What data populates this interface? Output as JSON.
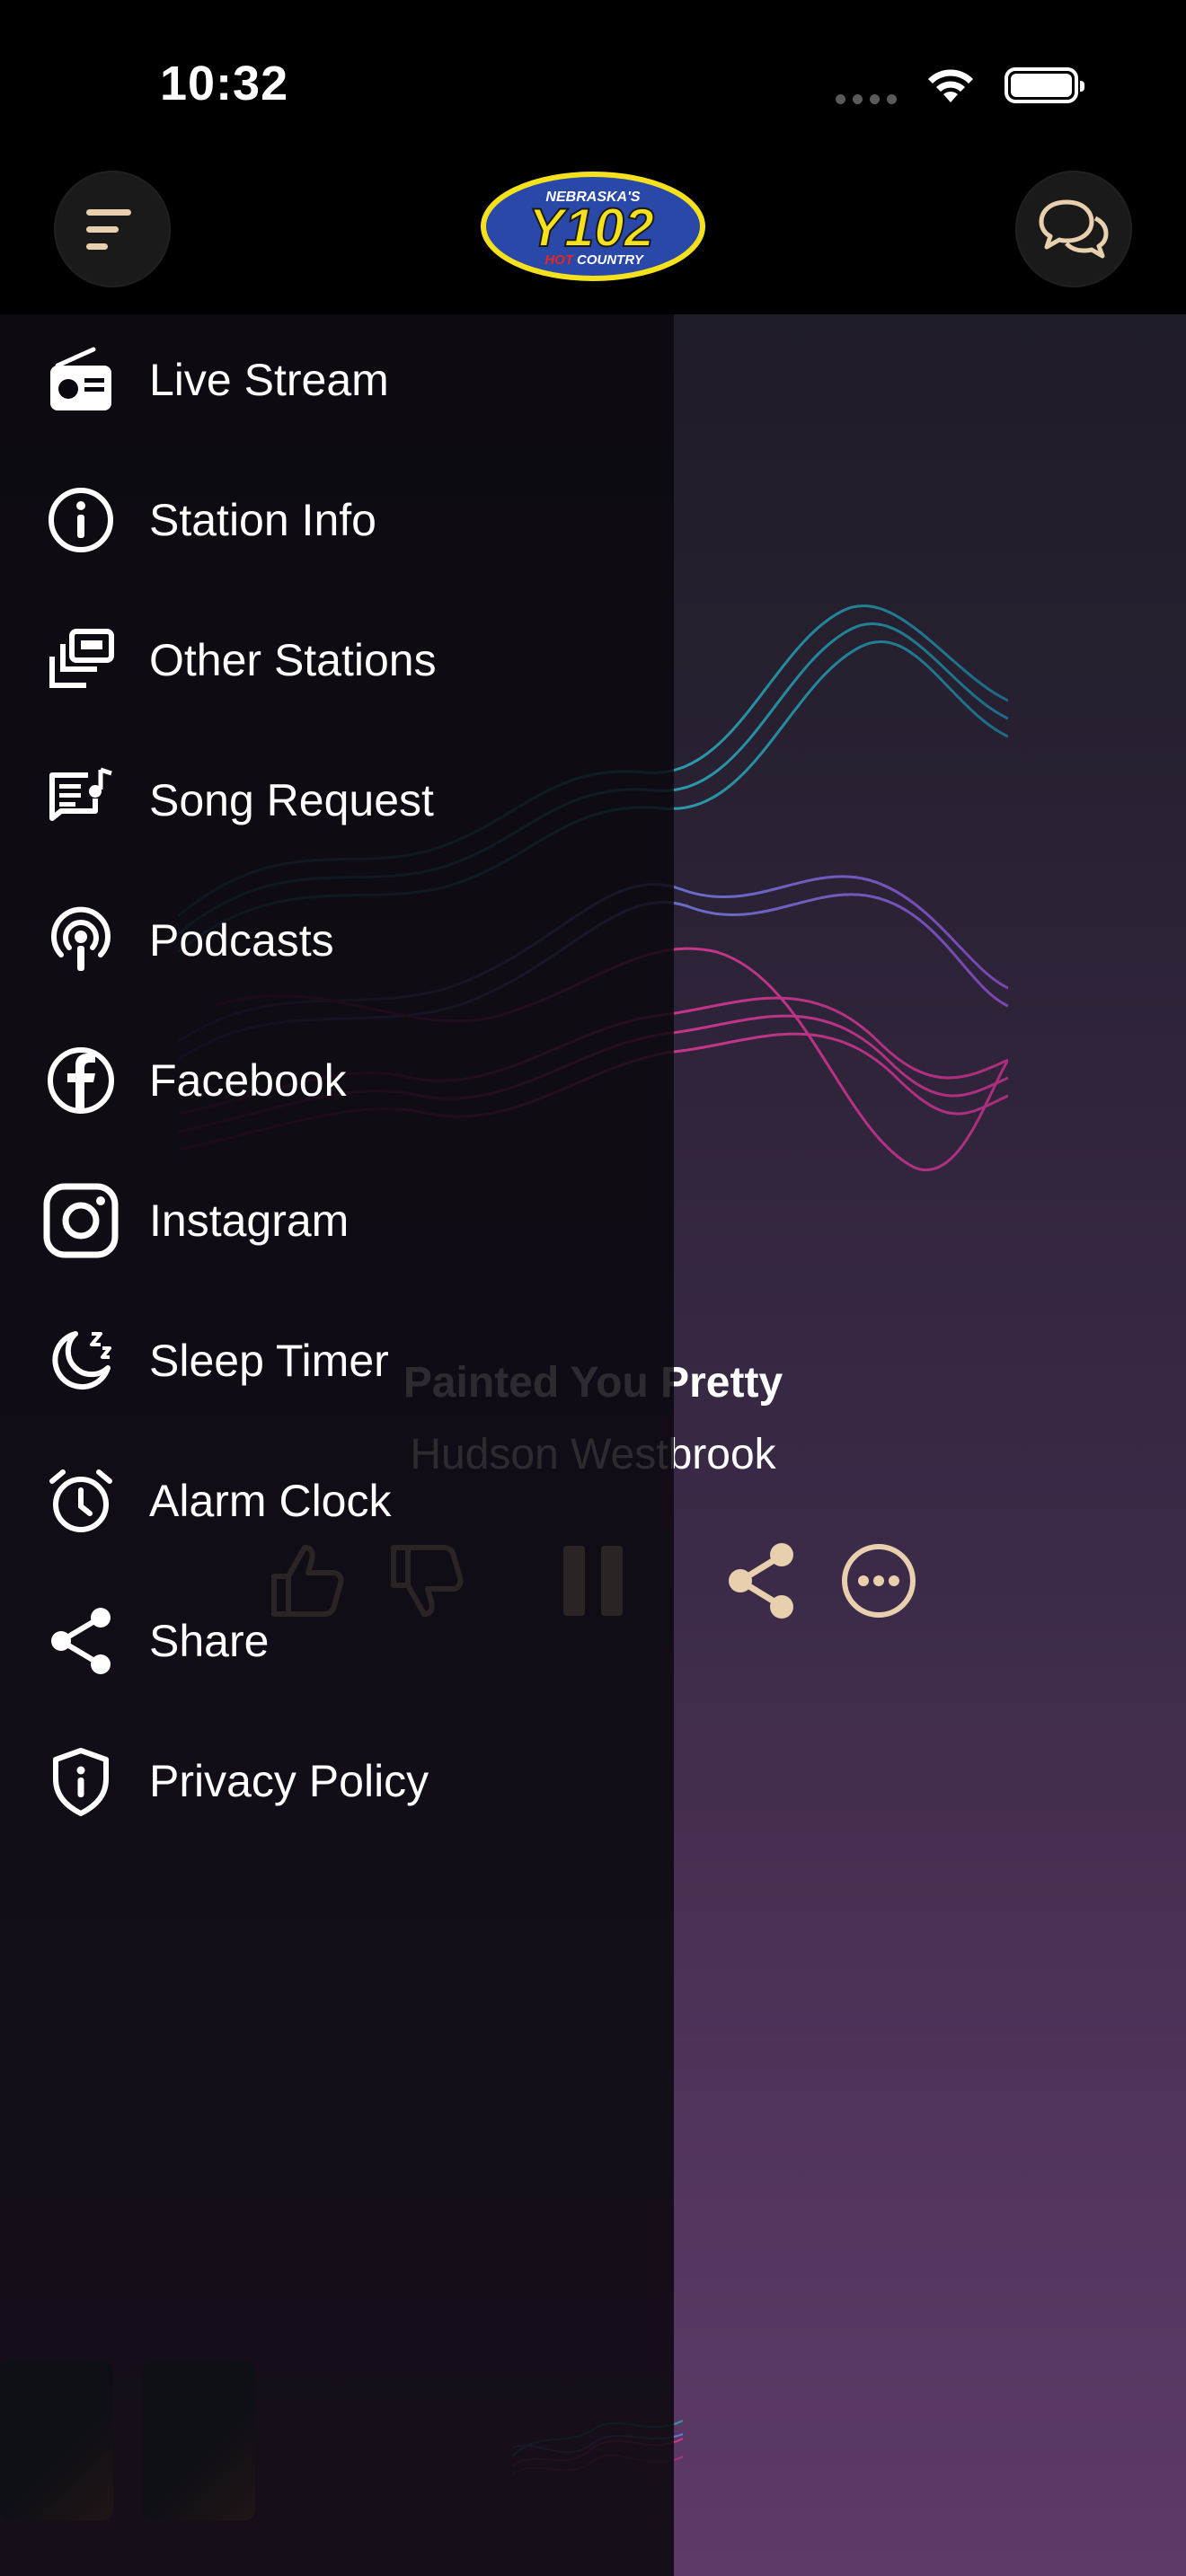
{
  "status_bar": {
    "time": "10:32"
  },
  "header": {
    "logo": {
      "top_text": "NEBRASKA'S",
      "main_text": "Y102",
      "bottom_text_red": "HOT",
      "bottom_text": "COUNTRY"
    }
  },
  "player": {
    "title": "Painted You Pretty",
    "artist": "Hudson Westbrook"
  },
  "drawer": {
    "items": [
      {
        "label": "Live Stream",
        "icon": "radio-icon"
      },
      {
        "label": "Station Info",
        "icon": "info-icon"
      },
      {
        "label": "Other Stations",
        "icon": "stations-icon"
      },
      {
        "label": "Song Request",
        "icon": "song-request-icon"
      },
      {
        "label": "Podcasts",
        "icon": "podcast-icon"
      },
      {
        "label": "Facebook",
        "icon": "facebook-icon"
      },
      {
        "label": "Instagram",
        "icon": "instagram-icon"
      },
      {
        "label": "Sleep Timer",
        "icon": "moon-icon"
      },
      {
        "label": "Alarm Clock",
        "icon": "alarm-clock-icon"
      },
      {
        "label": "Share",
        "icon": "share-icon"
      },
      {
        "label": "Privacy Policy",
        "icon": "shield-icon"
      }
    ]
  },
  "colors": {
    "accent": "#e8cfae",
    "background": "#000000",
    "drawer": "#0a080e"
  }
}
